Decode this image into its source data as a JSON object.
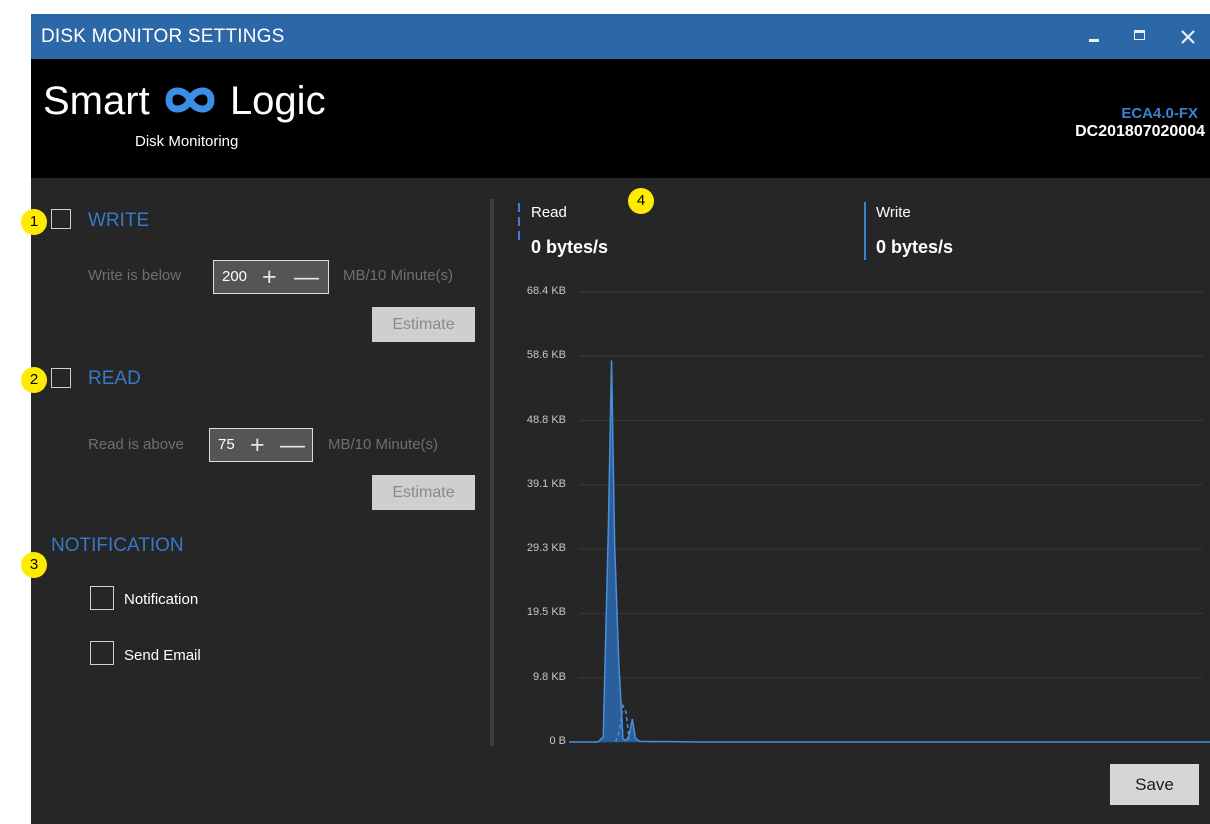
{
  "window": {
    "title": "DISK MONITOR SETTINGS",
    "controls": [
      "minimize-icon",
      "maximize-icon",
      "close-icon"
    ]
  },
  "header": {
    "brand_left": "Smart",
    "brand_right": "Logic",
    "brand_logo": "infinity-logo-icon",
    "subtitle": "Disk Monitoring",
    "model": "ECA4.0-FX",
    "serial": "DC201807020004"
  },
  "markers": [
    "1",
    "2",
    "3",
    "4"
  ],
  "write": {
    "title": "WRITE",
    "checked": false,
    "condition_label": "Write is below",
    "value": "200",
    "unit": "MB/10 Minute(s)",
    "estimate_label": "Estimate"
  },
  "read": {
    "title": "READ",
    "checked": false,
    "condition_label": "Read is above",
    "value": "75",
    "unit": "MB/10 Minute(s)",
    "estimate_label": "Estimate"
  },
  "notification": {
    "title": "NOTIFICATION",
    "options": [
      {
        "label": "Notification",
        "checked": false
      },
      {
        "label": "Send Email",
        "checked": false
      }
    ]
  },
  "stats": {
    "read_label": "Read",
    "read_value": "0 bytes/s",
    "write_label": "Write",
    "write_value": "0 bytes/s"
  },
  "colors": {
    "accent": "#2c67a7",
    "chart_fill": "#2b5f9c",
    "chart_line": "#4a8fdb",
    "marker": "#ffeb00",
    "background": "#262626"
  },
  "save_label": "Save",
  "chart_data": {
    "type": "area",
    "title": "",
    "xlabel": "",
    "ylabel": "",
    "ylim": [
      0,
      68.4
    ],
    "y_ticks": [
      "68.4 KB",
      "58.6 KB",
      "48.8 KB",
      "39.1 KB",
      "29.3 KB",
      "19.5 KB",
      "9.8 KB",
      "0 B"
    ],
    "grid": true,
    "series": [
      {
        "points": [
          [
            0,
            0
          ],
          [
            28,
            0
          ],
          [
            33,
            0.8
          ],
          [
            38,
            33
          ],
          [
            41,
            58
          ],
          [
            44,
            30
          ],
          [
            48,
            12
          ],
          [
            52,
            0.5
          ],
          [
            55,
            0.2
          ],
          [
            58,
            1
          ],
          [
            61,
            3.5
          ],
          [
            64,
            0.6
          ],
          [
            68,
            0.1
          ],
          [
            80,
            0.05
          ],
          [
            100,
            0.05
          ],
          [
            125,
            0
          ],
          [
            160,
            0
          ],
          [
            330,
            0
          ],
          [
            640,
            0
          ]
        ]
      },
      {
        "style": "dashed",
        "points": [
          [
            45,
            0
          ],
          [
            49,
            2
          ],
          [
            52,
            5.5
          ],
          [
            55,
            4.5
          ],
          [
            58,
            0.3
          ]
        ]
      }
    ]
  }
}
